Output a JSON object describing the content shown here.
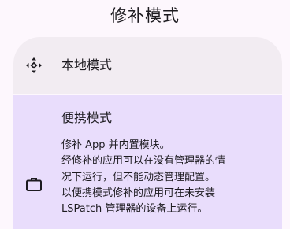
{
  "dialog": {
    "title": "修补模式"
  },
  "options": [
    {
      "id": "local",
      "label": "本地模式",
      "icon": "diamond-arrows-icon",
      "selected": false
    },
    {
      "id": "portable",
      "label": "便携模式",
      "icon": "briefcase-icon",
      "selected": true,
      "description_lines": [
        "修补 App 并内置模块。",
        "经修补的应用可以在没有管理器的情",
        "况下运行，但不能动态管理配置。",
        "以便携模式修补的应用可在未安装",
        "LSPatch 管理器的设备上运行。"
      ]
    }
  ],
  "colors": {
    "background": "#fdf7fd",
    "option_background": "#f2ecf2",
    "selected_background": "#e9ddfc",
    "text": "#1d1b20"
  }
}
